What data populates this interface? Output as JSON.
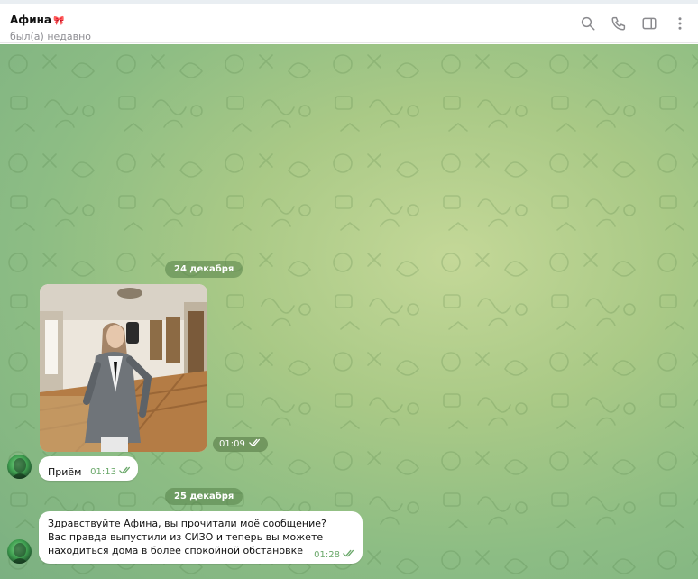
{
  "header": {
    "contact_name": "Афина",
    "name_emoji": "🎀",
    "last_seen": "был(а) недавно",
    "icons": [
      "search-icon",
      "phone-icon",
      "sidebar-toggle-icon",
      "more-vertical-icon"
    ]
  },
  "chat": {
    "dates": [
      "24 декабря",
      "25 декабря"
    ],
    "photo_message": {
      "time": "01:09",
      "status": "read"
    },
    "messages": [
      {
        "text": "Приём",
        "time": "01:13",
        "status": "read"
      },
      {
        "text": "Здравствуйте Афина, вы прочитали моё сообщение? Вас правда выпустили из СИЗО и теперь вы можете находиться дома в более спокойной обстановке",
        "time": "01:28",
        "status": "read"
      }
    ]
  },
  "colors": {
    "accent": "#6aa86a",
    "chat_bg": "#a9c986",
    "date_pill": "#568248",
    "bubble": "#ffffff"
  }
}
